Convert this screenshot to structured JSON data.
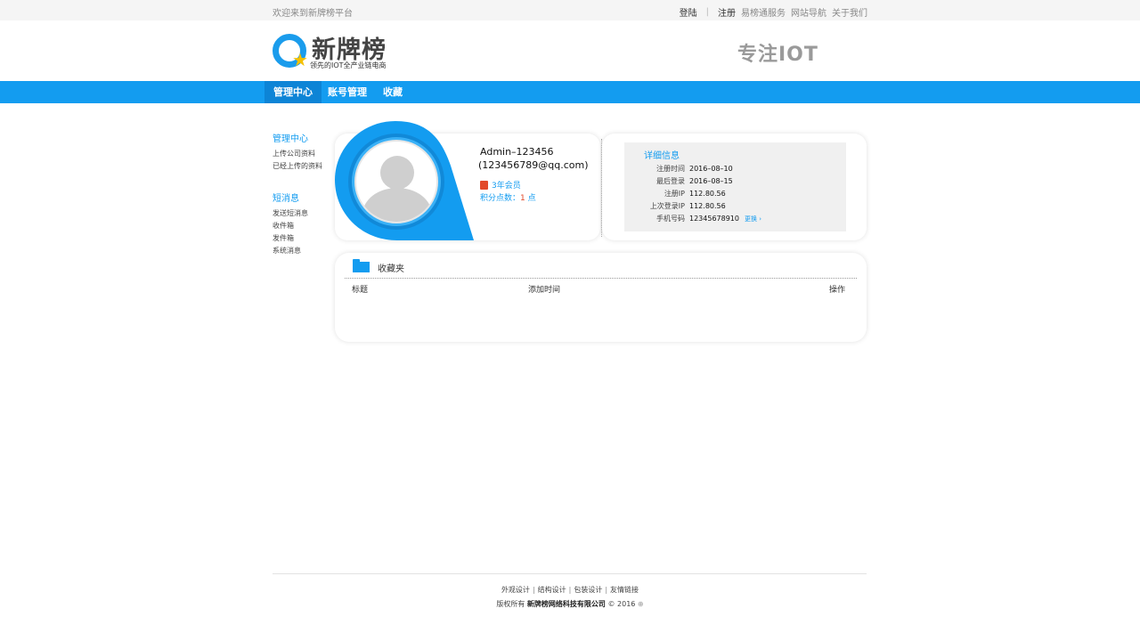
{
  "topbar": {
    "welcome": "欢迎来到新牌榜平台",
    "login": "登陆",
    "register": "注册",
    "service": "易榜通服务",
    "sitenav": "网站导航",
    "about": "关于我们"
  },
  "header": {
    "brand": "新牌榜",
    "tagline": "领先的IOT全产业链电商",
    "slogan": "专注IOT"
  },
  "nav": {
    "items": [
      "管理中心",
      "账号管理",
      "收藏"
    ]
  },
  "sidebar": {
    "group1": {
      "title": "管理中心",
      "items": [
        "上传公司资料",
        "已经上传的资料"
      ]
    },
    "group2": {
      "title": "短消息",
      "items": [
        "发送短消息",
        "收件箱",
        "发件箱",
        "系统消息"
      ]
    }
  },
  "profile": {
    "username": "Admin–123456",
    "email": "(123456789@qq.com)",
    "membership": "3年会员",
    "points_label": "积分点数：",
    "points_value": "1",
    "points_unit": " 点"
  },
  "details": {
    "title": "详细信息",
    "rows": [
      {
        "label": "注册时间",
        "value": "2016–08–10"
      },
      {
        "label": "最后登录",
        "value": "2016–08–15"
      },
      {
        "label": "注册IP",
        "value": "112.80.56"
      },
      {
        "label": "上次登录IP",
        "value": "112.80.56"
      },
      {
        "label": "手机号码",
        "value": "12345678910"
      }
    ],
    "change_label": "更换 ›"
  },
  "favorites": {
    "title": "收藏夹",
    "columns": [
      "标题",
      "添加时间",
      "操作"
    ]
  },
  "footer": {
    "links": [
      "外观设计",
      "结构设计",
      "包装设计",
      "友情链接"
    ],
    "copy_prefix": "版权所有",
    "company": "新牌榜网络科技有限公司",
    "copy_suffix": "© 2016"
  },
  "colors": {
    "accent": "#139cf0",
    "nav_active": "#0d84d6",
    "highlight": "#e24a2a"
  }
}
